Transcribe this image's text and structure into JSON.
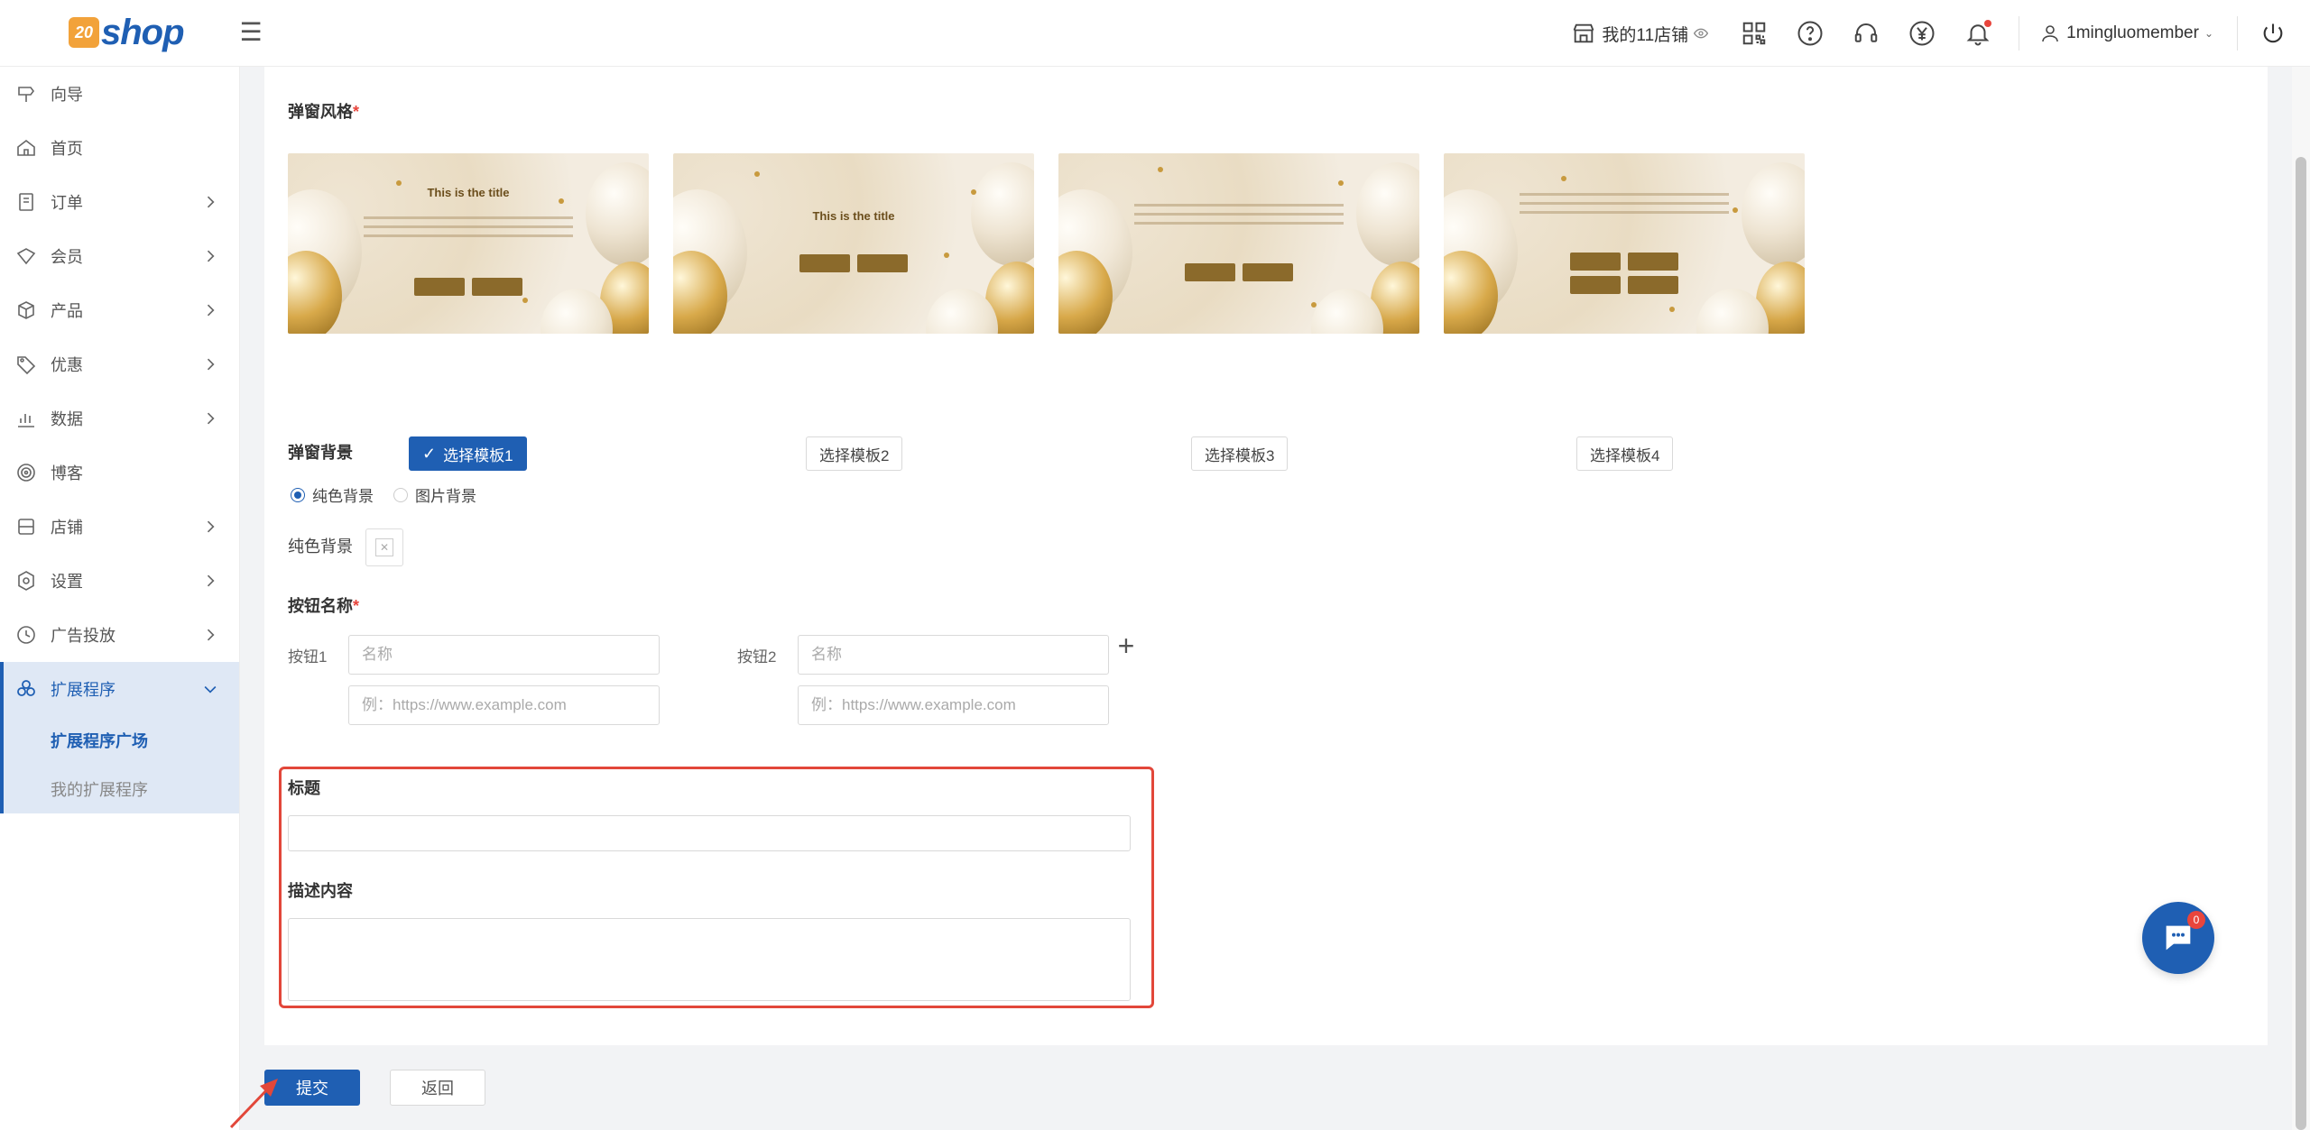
{
  "brand": {
    "logo_badge": "20",
    "logo_word": "shop",
    "accent": "#1f5fb3"
  },
  "header": {
    "store_label": "我的11店铺",
    "username": "1mingluomember"
  },
  "sidebar": {
    "items": [
      {
        "label": "向导",
        "icon": "guide-icon"
      },
      {
        "label": "首页",
        "icon": "home-icon"
      },
      {
        "label": "订单",
        "icon": "order-icon"
      },
      {
        "label": "会员",
        "icon": "member-icon"
      },
      {
        "label": "产品",
        "icon": "product-icon"
      },
      {
        "label": "优惠",
        "icon": "discount-icon"
      },
      {
        "label": "数据",
        "icon": "data-icon"
      },
      {
        "label": "博客",
        "icon": "blog-icon"
      },
      {
        "label": "店铺",
        "icon": "store-icon"
      },
      {
        "label": "设置",
        "icon": "settings-icon"
      },
      {
        "label": "广告投放",
        "icon": "ads-icon"
      },
      {
        "label": "扩展程序",
        "icon": "extensions-icon"
      }
    ],
    "sub_items": [
      {
        "label": "扩展程序广场"
      },
      {
        "label": "我的扩展程序"
      }
    ]
  },
  "form": {
    "popup_style_label": "弹窗风格",
    "required_mark": "*",
    "templates": [
      {
        "title": "This is the title",
        "choose_label": "选择模板1",
        "selected": true
      },
      {
        "title": "This is the title",
        "choose_label": "选择模板2",
        "selected": false
      },
      {
        "title": "",
        "choose_label": "选择模板3",
        "selected": false
      },
      {
        "title": "",
        "choose_label": "选择模板4",
        "selected": false
      }
    ],
    "template_button_text": "Button",
    "background_label": "弹窗背景",
    "bg_option_solid": "纯色背景",
    "bg_option_image": "图片背景",
    "solid_color_label": "纯色背景",
    "button_name_label": "按钮名称",
    "button1_label": "按钮1",
    "button2_label": "按钮2",
    "name_placeholder": "名称",
    "url_placeholder": "例：https://www.example.com",
    "title_label": "标题",
    "description_label": "描述内容",
    "title_value": "",
    "description_value": ""
  },
  "actions": {
    "submit_label": "提交",
    "back_label": "返回"
  },
  "chat": {
    "unread_count": "0"
  },
  "colors": {
    "primary": "#1f5fb3",
    "danger": "#e2473a"
  }
}
